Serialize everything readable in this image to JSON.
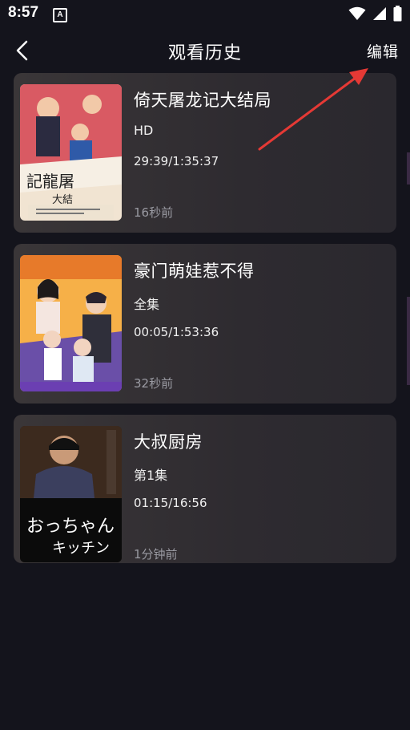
{
  "status_bar": {
    "time": "8:57",
    "notification_icon": "a-icon",
    "icons": [
      "wifi-icon",
      "signal-icon",
      "battery-icon"
    ]
  },
  "header": {
    "title": "观看历史",
    "edit_label": "编辑",
    "back_icon": "chevron-left-icon"
  },
  "history": [
    {
      "title": "倚天屠龙记大结局",
      "episode": "HD",
      "progress": "29:39/1:35:37",
      "time_ago": "16秒前",
      "thumb_palette": "#d95a63"
    },
    {
      "title": "豪门萌娃惹不得",
      "episode": "全集",
      "progress": "00:05/1:53:36",
      "time_ago": "32秒前",
      "thumb_palette": "#e8772a"
    },
    {
      "title": "大叔厨房",
      "episode": "第1集",
      "progress": "01:15/16:56",
      "time_ago": "1分钟前",
      "thumb_palette": "#2a1d16"
    }
  ],
  "annotation": {
    "color": "#e53935"
  }
}
